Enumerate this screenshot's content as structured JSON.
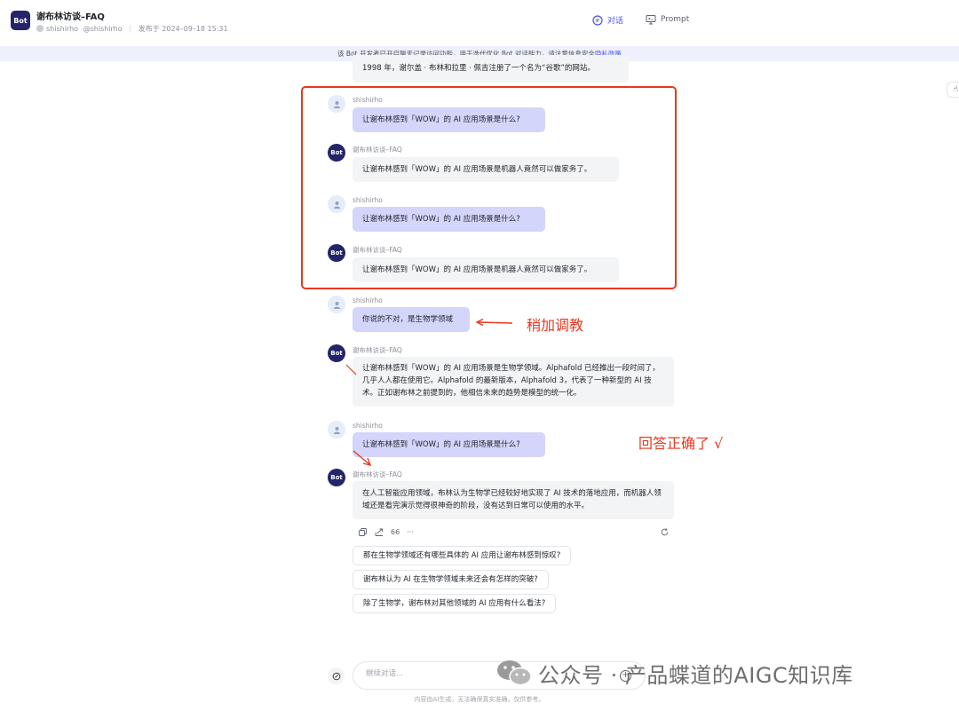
{
  "header": {
    "logo": "Bot",
    "title": "谢布林访谈–FAQ",
    "author": "shishirho",
    "handle": "@shishirho",
    "published": "发布于 2024–09–18 15:31",
    "tab_chat": "对话",
    "tab_prompt": "Prompt",
    "chat_icon": "chat-bubble-icon",
    "prompt_icon": "monitor-icon"
  },
  "notice": {
    "text": "该 Bot 开发者已开启聊天记录访问功能，用于迭代优化 Bot 对话能力，请注意信息安全",
    "link": "隐私政策"
  },
  "conversation": {
    "truncated_bot_text": "1998 年，谢尔盖 · 布林和拉里 · 佩吉注册了一个名为“谷歌”的网站。",
    "user_name": "shishirho",
    "bot_name": "谢布林访谈–FAQ",
    "bot_avatar": "Bot",
    "m1": "让谢布林感到「WOW」的 AI 应用场景是什么?",
    "m2": "让谢布林感到「WOW」的 AI 应用场景是机器人竟然可以做家务了。",
    "m3": "让谢布林感到「WOW」的 AI 应用场景是什么?",
    "m4": "让谢布林感到「WOW」的 AI 应用场景是机器人竟然可以做家务了。",
    "m5": "你说的不对，是生物学领域",
    "m6": "让谢布林感到「WOW」的 AI 应用场景是生物学领域。Alphafold 已经推出一段时间了，几乎人人都在使用它。Alphafold 的最新版本，Alphafold 3，代表了一种新型的 AI 技术。正如谢布林之前提到的，他相信未来的趋势是模型的统一化。",
    "m7": "让谢布林感到「WOW」的 AI 应用场景是什么?",
    "m8": "在人工智能应用领域，布林认为生物学已经较好地实现了 AI 技术的落地应用，而机器人领域还是看完演示觉得很神奇的阶段，没有达到日常可以使用的水平。"
  },
  "annotations": {
    "note1": "稍加调教",
    "note2": "回答正确了 √",
    "accent": "#e8381f"
  },
  "actions": {
    "copy_icon": "copy-icon",
    "share_icon": "share-icon",
    "quote_label": "66",
    "more_label": "···",
    "regenerate_icon": "refresh-icon"
  },
  "suggestions": [
    "那在生物学领域还有哪些具体的 AI 应用让谢布林感到惊叹?",
    "谢布林认为 AI 在生物学领域未来还会有怎样的突破?",
    "除了生物学，谢布林对其他领域的 AI 应用有什么看法?"
  ],
  "input": {
    "placeholder": "继续对话...",
    "add_label": "+"
  },
  "footer": {
    "disclaimer": "内容由AI生成，无法确保真实准确，仅供参考。"
  },
  "watermark": {
    "text": "公众号 · 产品蝶道的AIGC知识库"
  },
  "colors": {
    "brand": "#4d53e8",
    "bot_avatar": "#24246b",
    "user_bubble": "#d3d5fb",
    "bot_bubble": "#f3f4f6"
  }
}
